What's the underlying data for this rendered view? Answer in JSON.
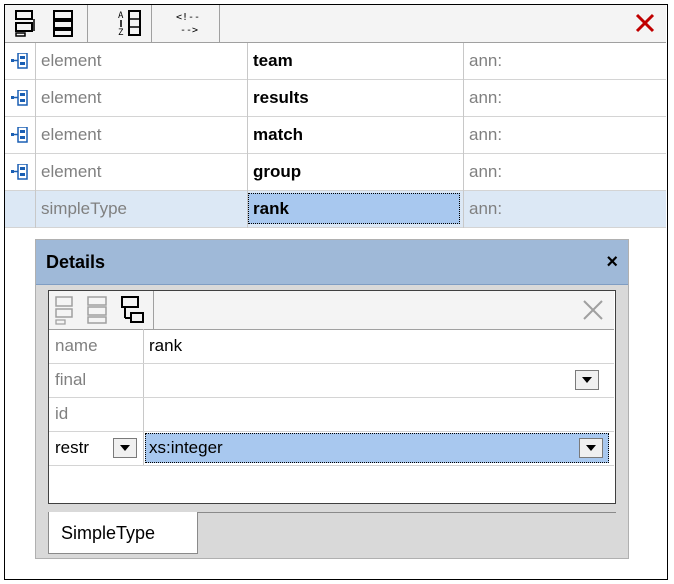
{
  "toolbar": {
    "buttons": [
      {
        "icon": "append-element-icon"
      },
      {
        "icon": "insert-element-icon"
      },
      {
        "icon": "sort-az-icon"
      },
      {
        "icon": "comment-icon"
      }
    ],
    "close_icon": "delete-x-icon",
    "close_color": "#c00000"
  },
  "rows": [
    {
      "kind": "element",
      "name": "team",
      "ann": "ann:"
    },
    {
      "kind": "element",
      "name": "results",
      "ann": "ann:"
    },
    {
      "kind": "element",
      "name": "match",
      "ann": "ann:"
    },
    {
      "kind": "element",
      "name": "group",
      "ann": "ann:"
    },
    {
      "kind": "simpleType",
      "name": "rank",
      "ann": "ann:"
    }
  ],
  "details": {
    "title": "Details",
    "close_glyph": "×",
    "fields": [
      {
        "label": "name",
        "value": "rank"
      },
      {
        "label": "final",
        "value": ""
      },
      {
        "label": "id",
        "value": ""
      },
      {
        "label": "restr",
        "value": "xs:integer"
      }
    ],
    "tab": "SimpleType"
  },
  "colors": {
    "selection": "#a8c8ef",
    "selected_row": "#dce8f5",
    "panel_header": "#9fb9d8"
  }
}
